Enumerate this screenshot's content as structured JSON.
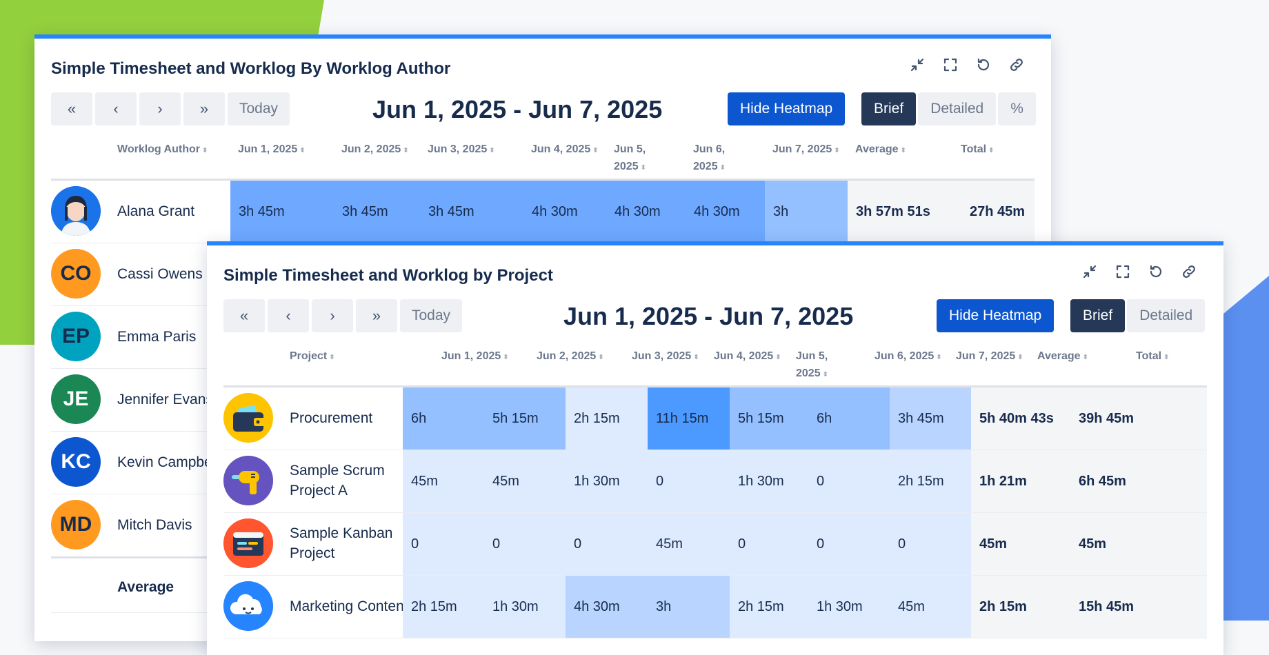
{
  "panel1": {
    "title": "Simple Timesheet and Worklog By Worklog Author",
    "range": "Jun 1, 2025 - Jun 7, 2025",
    "nav": [
      "«",
      "‹",
      "›",
      "»"
    ],
    "today": "Today",
    "heatmap_btn": "Hide Heatmap",
    "views": [
      "Brief",
      "Detailed",
      "%"
    ],
    "columns": [
      "Worklog Author",
      "Jun 1, 2025",
      "Jun 2, 2025",
      "Jun 3, 2025",
      "Jun 4, 2025",
      "Jun 5, 2025",
      "Jun 6, 2025",
      "Jun 7, 2025",
      "Average",
      "Total"
    ],
    "rows": [
      {
        "initials": "",
        "name": "Alana Grant",
        "cells": [
          "3h 45m",
          "3h 45m",
          "3h 45m",
          "4h 30m",
          "4h 30m",
          "4h 30m",
          "3h",
          "3h 57m 51s",
          "27h 45m"
        ]
      },
      {
        "initials": "CO",
        "name": "Cassi Owens"
      },
      {
        "initials": "EP",
        "name": "Emma Paris"
      },
      {
        "initials": "JE",
        "name": "Jennifer Evans"
      },
      {
        "initials": "KC",
        "name": "Kevin Campbell"
      },
      {
        "initials": "MD",
        "name": "Mitch Davis"
      }
    ],
    "average_label": "Average"
  },
  "panel2": {
    "title": "Simple Timesheet and Worklog by Project",
    "range": "Jun 1, 2025 - Jun 7, 2025",
    "nav": [
      "«",
      "‹",
      "›",
      "»"
    ],
    "today": "Today",
    "heatmap_btn": "Hide Heatmap",
    "views": [
      "Brief",
      "Detailed"
    ],
    "columns": [
      "Project",
      "Jun 1, 2025",
      "Jun 2, 2025",
      "Jun 3, 2025",
      "Jun 4, 2025",
      "Jun 5, 2025",
      "Jun 6, 2025",
      "Jun 7, 2025",
      "Average",
      "Total"
    ],
    "rows": [
      {
        "name": "Procurement",
        "icon": "wallet-icon",
        "cells": [
          "6h",
          "5h 15m",
          "2h 15m",
          "11h 15m",
          "5h 15m",
          "6h",
          "3h 45m",
          "5h 40m 43s",
          "39h 45m"
        ]
      },
      {
        "name": "Sample Scrum Project A",
        "icon": "hair-dryer-icon",
        "cells": [
          "45m",
          "45m",
          "1h 30m",
          "0",
          "1h 30m",
          "0",
          "2h 15m",
          "1h 21m",
          "6h 45m"
        ]
      },
      {
        "name": "Sample Kanban Project",
        "icon": "code-window-icon",
        "cells": [
          "0",
          "0",
          "0",
          "45m",
          "0",
          "0",
          "0",
          "45m",
          "45m"
        ]
      },
      {
        "name": "Marketing Content",
        "icon": "cloud-icon",
        "cells": [
          "2h 15m",
          "1h 30m",
          "4h 30m",
          "3h",
          "2h 15m",
          "1h 30m",
          "45m",
          "2h 15m",
          "15h 45m"
        ]
      }
    ]
  },
  "colors": {
    "heat_dark": "#4c9aff",
    "heat_mid": "#6ea8ff",
    "heat_light": "#94c0ff",
    "heat_pale": "#b8d4ff",
    "heat_faint": "#deebff",
    "accent": "#0c56d0",
    "panel_border": "#2684ff"
  }
}
